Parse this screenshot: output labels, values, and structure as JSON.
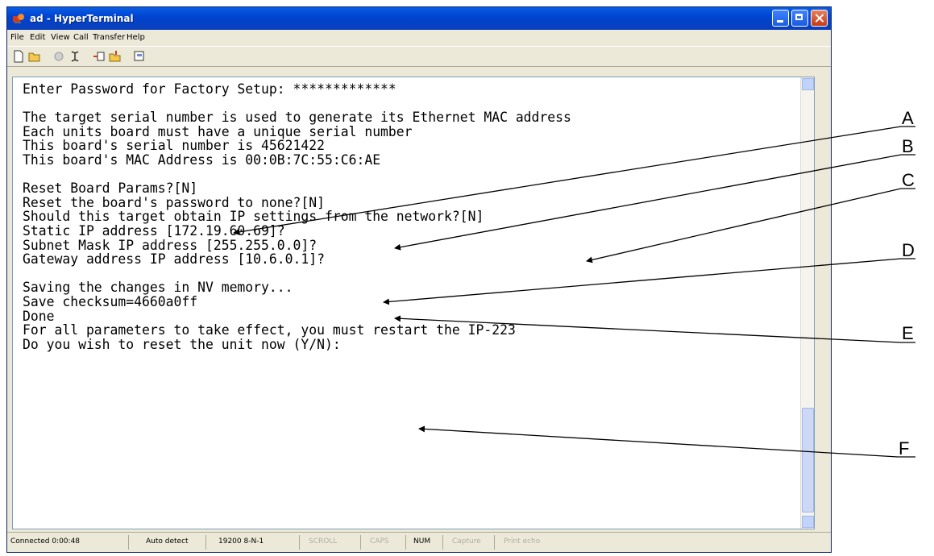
{
  "window": {
    "title": "ad - HyperTerminal"
  },
  "menu": [
    "File",
    "Edit",
    "View",
    "Call",
    "Transfer",
    "Help"
  ],
  "toolbar": [
    "new-icon",
    "open-icon",
    "call-icon",
    "disconnect-icon",
    "send-icon",
    "receive-icon",
    "properties-icon"
  ],
  "terminal": {
    "text": "Enter Password for Factory Setup: *************\n\nThe target serial number is used to generate its Ethernet MAC address\nEach units board must have a unique serial number\nThis board's serial number is 45621422\nThis board's MAC Address is 00:0B:7C:55:C6:AE\n\nReset Board Params?[N]\nReset the board's password to none?[N]\nShould this target obtain IP settings from the network?[N]\nStatic IP address [172.19.60.69]?\nSubnet Mask IP address [255.255.0.0]?\nGateway address IP address [10.6.0.1]?\n\nSaving the changes in NV memory...\nSave checksum=4660a0ff\nDone\nFor all parameters to take effect, you must restart the IP-223\nDo you wish to reset the unit now (Y/N):"
  },
  "status": {
    "connected": "Connected 0:00:48",
    "detect": "Auto detect",
    "settings": "19200 8-N-1",
    "scroll": "SCROLL",
    "caps": "CAPS",
    "num": "NUM",
    "capture": "Capture",
    "print_echo": "Print echo"
  },
  "callouts": [
    "A",
    "B",
    "C",
    "D",
    "E",
    "F"
  ]
}
